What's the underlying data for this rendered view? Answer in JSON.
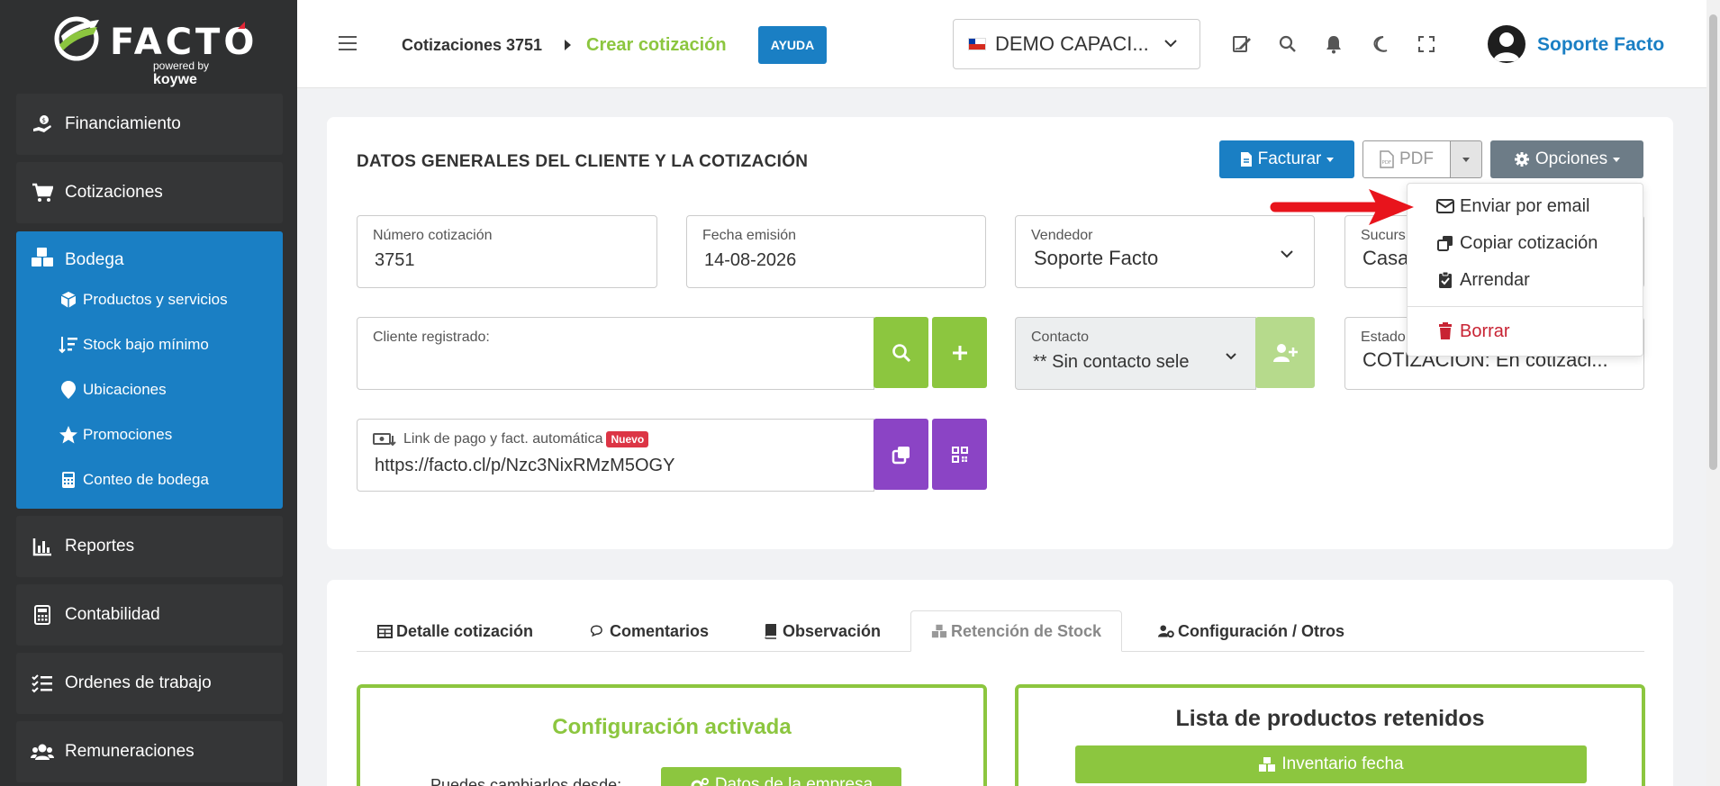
{
  "brand": {
    "name": "FACTO",
    "powered": "powered",
    "by": "by",
    "partner": "koywe"
  },
  "sidebar": {
    "items": [
      {
        "label": "Financiamiento",
        "icon": "hand-money-icon"
      },
      {
        "label": "Cotizaciones",
        "icon": "cart-icon"
      },
      {
        "label": "Bodega",
        "icon": "boxes-icon"
      },
      {
        "label": "Reportes",
        "icon": "chart-icon"
      },
      {
        "label": "Contabilidad",
        "icon": "calculator-icon"
      },
      {
        "label": "Ordenes de trabajo",
        "icon": "tasks-icon"
      },
      {
        "label": "Remuneraciones",
        "icon": "users-icon"
      }
    ],
    "bodega_sub": [
      {
        "label": "Productos y servicios"
      },
      {
        "label": "Stock bajo mínimo"
      },
      {
        "label": "Ubicaciones"
      },
      {
        "label": "Promociones"
      },
      {
        "label": "Conteo de bodega"
      }
    ]
  },
  "header": {
    "crumb_parent": "Cotizaciones 3751",
    "crumb_current": "Crear cotización",
    "help": "AYUDA",
    "company": "DEMO CAPACI...",
    "user": "Soporte Facto"
  },
  "main": {
    "title": "DATOS GENERALES DEL CLIENTE Y LA COTIZACIÓN",
    "buttons": {
      "facturar": "Facturar",
      "pdf": "PDF",
      "opciones": "Opciones"
    },
    "fields": {
      "numero_label": "Número cotización",
      "numero_value": "3751",
      "fecha_label": "Fecha emisión",
      "fecha_value": "14-08-2026",
      "vendedor_label": "Vendedor",
      "vendedor_value": "Soporte Facto",
      "sucursal_label": "Sucurs",
      "sucursal_value": "Casa",
      "cliente_label": "Cliente registrado:",
      "contacto_label": "Contacto",
      "contacto_value": "** Sin contacto sele",
      "estado_label": "Estado",
      "estado_value": "COTIZACIÓN: En cotizaci...",
      "link_label": "Link de pago y fact. automática",
      "link_badge": "Nuevo",
      "link_value": "https://facto.cl/p/Nzc3NixRMzM5OGY"
    }
  },
  "options_menu": {
    "items": [
      {
        "label": "Enviar por email",
        "icon": "envelope-icon"
      },
      {
        "label": "Copiar cotización",
        "icon": "copy-icon"
      },
      {
        "label": "Arrendar",
        "icon": "clipboard-check-icon"
      },
      {
        "label": "Borrar",
        "icon": "trash-icon"
      }
    ]
  },
  "tabs": [
    {
      "label": "Detalle cotización",
      "icon": "table-icon"
    },
    {
      "label": "Comentarios",
      "icon": "comments-icon"
    },
    {
      "label": "Observación",
      "icon": "book-icon"
    },
    {
      "label": "Retención de Stock",
      "icon": "boxes-icon",
      "active": true
    },
    {
      "label": "Configuración / Otros",
      "icon": "user-gear-icon"
    }
  ],
  "stock": {
    "config_title": "Configuración activada",
    "config_text": "Puedes cambiarlos desde:",
    "config_button": "Datos de la empresa",
    "list_title": "Lista de productos retenidos",
    "list_button": "Inventario fecha"
  },
  "colors": {
    "blue": "#1a7fc4",
    "green": "#8cc63f",
    "purple": "#8b44c5",
    "sidebar": "#2f3031",
    "danger": "#c82333"
  }
}
